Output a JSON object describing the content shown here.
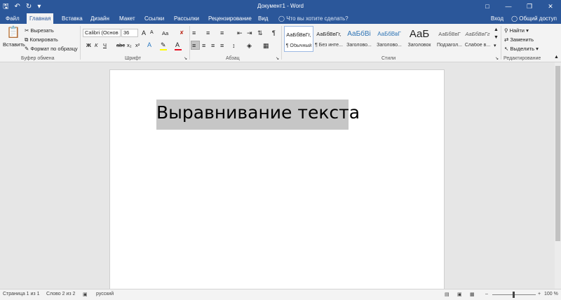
{
  "window": {
    "title": "Документ1 - Word",
    "signin": "Вход",
    "share": "Общий доступ",
    "tell_me": "Что вы хотите сделать?"
  },
  "tabs": [
    "Файл",
    "Главная",
    "Вставка",
    "Дизайн",
    "Макет",
    "Ссылки",
    "Рассылки",
    "Рецензирование",
    "Вид"
  ],
  "clipboard": {
    "paste": "Вставить",
    "cut": "Вырезать",
    "copy": "Копировать",
    "format_painter": "Формат по образцу",
    "label": "Буфер обмена"
  },
  "font": {
    "name": "Calibri (Основ",
    "size": "36",
    "label": "Шрифт",
    "bold": "Ж",
    "italic": "К",
    "underline": "Ч",
    "strike": "abc",
    "subscript": "x₂",
    "superscript": "x²",
    "grow": "A",
    "shrink": "A",
    "case": "Aa",
    "color_letter": "А"
  },
  "paragraph": {
    "label": "Абзац"
  },
  "styles": {
    "label": "Стили",
    "items": [
      {
        "sample": "АаБбВвГг,",
        "name": "¶ Обычный"
      },
      {
        "sample": "АаБбВвГг,",
        "name": "¶ Без инте..."
      },
      {
        "sample": "АаБбВі",
        "name": "Заголово..."
      },
      {
        "sample": "АаБбВвГ",
        "name": "Заголово..."
      },
      {
        "sample": "АаБ",
        "name": "Заголовок"
      },
      {
        "sample": "АаБбВвГ",
        "name": "Подзагол..."
      },
      {
        "sample": "АаБбВвГг",
        "name": "Слабое в..."
      }
    ]
  },
  "editing": {
    "find": "Найти",
    "replace": "Заменить",
    "select": "Выделить",
    "label": "Редактирование"
  },
  "document": {
    "text": "Выравнивание текста"
  },
  "status": {
    "page": "Страница 1 из 1",
    "words": "Слово 2 из 2",
    "language": "русский",
    "zoom": "100 %"
  },
  "colors": {
    "accent": "#2b579a",
    "selection": "#c6c6c6",
    "font_color_bar": "#e81123",
    "highlight_bar": "#ffff00"
  }
}
